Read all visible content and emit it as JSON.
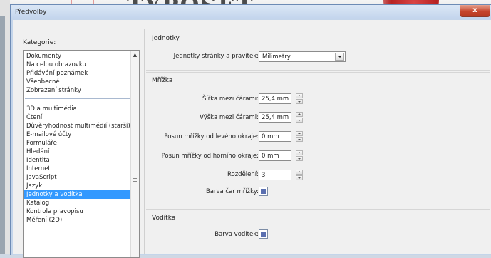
{
  "window": {
    "title": "Předvolby",
    "close_glyph": "x"
  },
  "background": {
    "logo_text": "TYPOSET"
  },
  "sidebar": {
    "label": "Kategorie:",
    "group1": [
      "Dokumenty",
      "Na celou obrazovku",
      "Přidávání poznámek",
      "Všeobecné",
      "Zobrazení stránky"
    ],
    "group2": [
      "3D a multimédia",
      "Čtení",
      "Důvěryhodnost multimédií (starší)",
      "E-mailové účty",
      "Formuláře",
      "Hledání",
      "Identita",
      "Internet",
      "JavaScript",
      "Jazyk",
      "Jednotky a vodítka",
      "Katalog",
      "Kontrola pravopisu",
      "Měření (2D)"
    ],
    "selected": "Jednotky a vodítka"
  },
  "units": {
    "title": "Jednotky",
    "label": "Jednotky stránky a pravítek:",
    "value": "Milimetry"
  },
  "grid": {
    "title": "Mřížka",
    "width_label": "Šířka mezi čárami:",
    "width_value": "25,4 mm",
    "height_label": "Výška mezi čárami:",
    "height_value": "25,4 mm",
    "offset_left_label": "Posun mřížky od levého okraje:",
    "offset_left_value": "0 mm",
    "offset_top_label": "Posun mřížky od horního okraje:",
    "offset_top_value": "0 mm",
    "subdiv_label": "Rozdělení:",
    "subdiv_value": "3",
    "color_label": "Barva čar mřížky:",
    "color": "#5a6fb0"
  },
  "guides": {
    "title": "Vodítka",
    "color_label": "Barva vodítek:",
    "color": "#5a6fb0"
  }
}
